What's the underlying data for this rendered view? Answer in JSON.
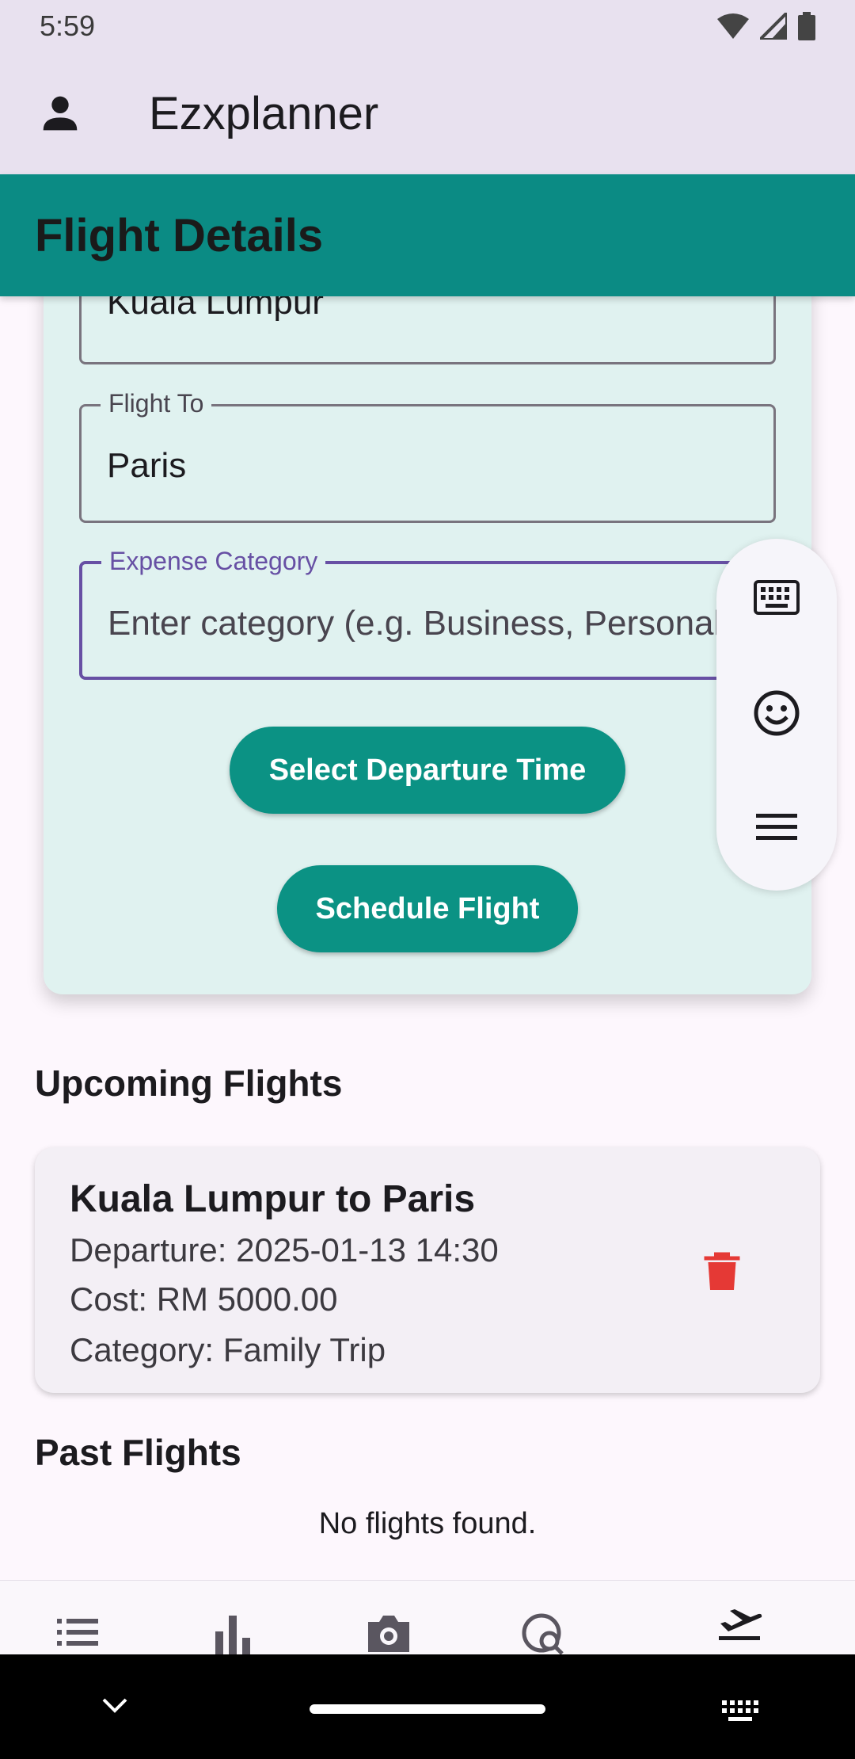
{
  "status_bar": {
    "time": "5:59"
  },
  "app_bar": {
    "title": "Ezxplanner"
  },
  "section_header": {
    "title": "Flight Details"
  },
  "form": {
    "flight_from": {
      "value": "Kuala Lumpur"
    },
    "flight_to": {
      "label": "Flight To",
      "value": "Paris"
    },
    "expense_category": {
      "label": "Expense Category",
      "placeholder": "Enter category (e.g. Business, Personal)"
    },
    "select_time_button": "Select Departure Time",
    "schedule_button": "Schedule Flight"
  },
  "keyboard_panel": {
    "icons": [
      "keyboard-icon",
      "emoji-icon",
      "menu-icon"
    ]
  },
  "upcoming": {
    "heading": "Upcoming Flights",
    "flights": [
      {
        "route": "Kuala Lumpur to Paris",
        "departure": "Departure: 2025-01-13 14:30",
        "cost": "Cost: RM 5000.00",
        "category": "Category: Family Trip"
      }
    ]
  },
  "past": {
    "heading": "Past Flights",
    "empty_text": "No flights found."
  },
  "bottom_nav": {
    "items": [
      "list-icon",
      "bar-chart-icon",
      "camera-icon",
      "travel-explore-icon",
      "flight-takeoff-icon"
    ],
    "active": "flight-takeoff-icon"
  },
  "colors": {
    "header_teal": "#0b8b84",
    "button_teal": "#0b9284",
    "card_bg": "#e0f2f0",
    "focus_purple": "#6750a4",
    "delete_red": "#e53935"
  }
}
